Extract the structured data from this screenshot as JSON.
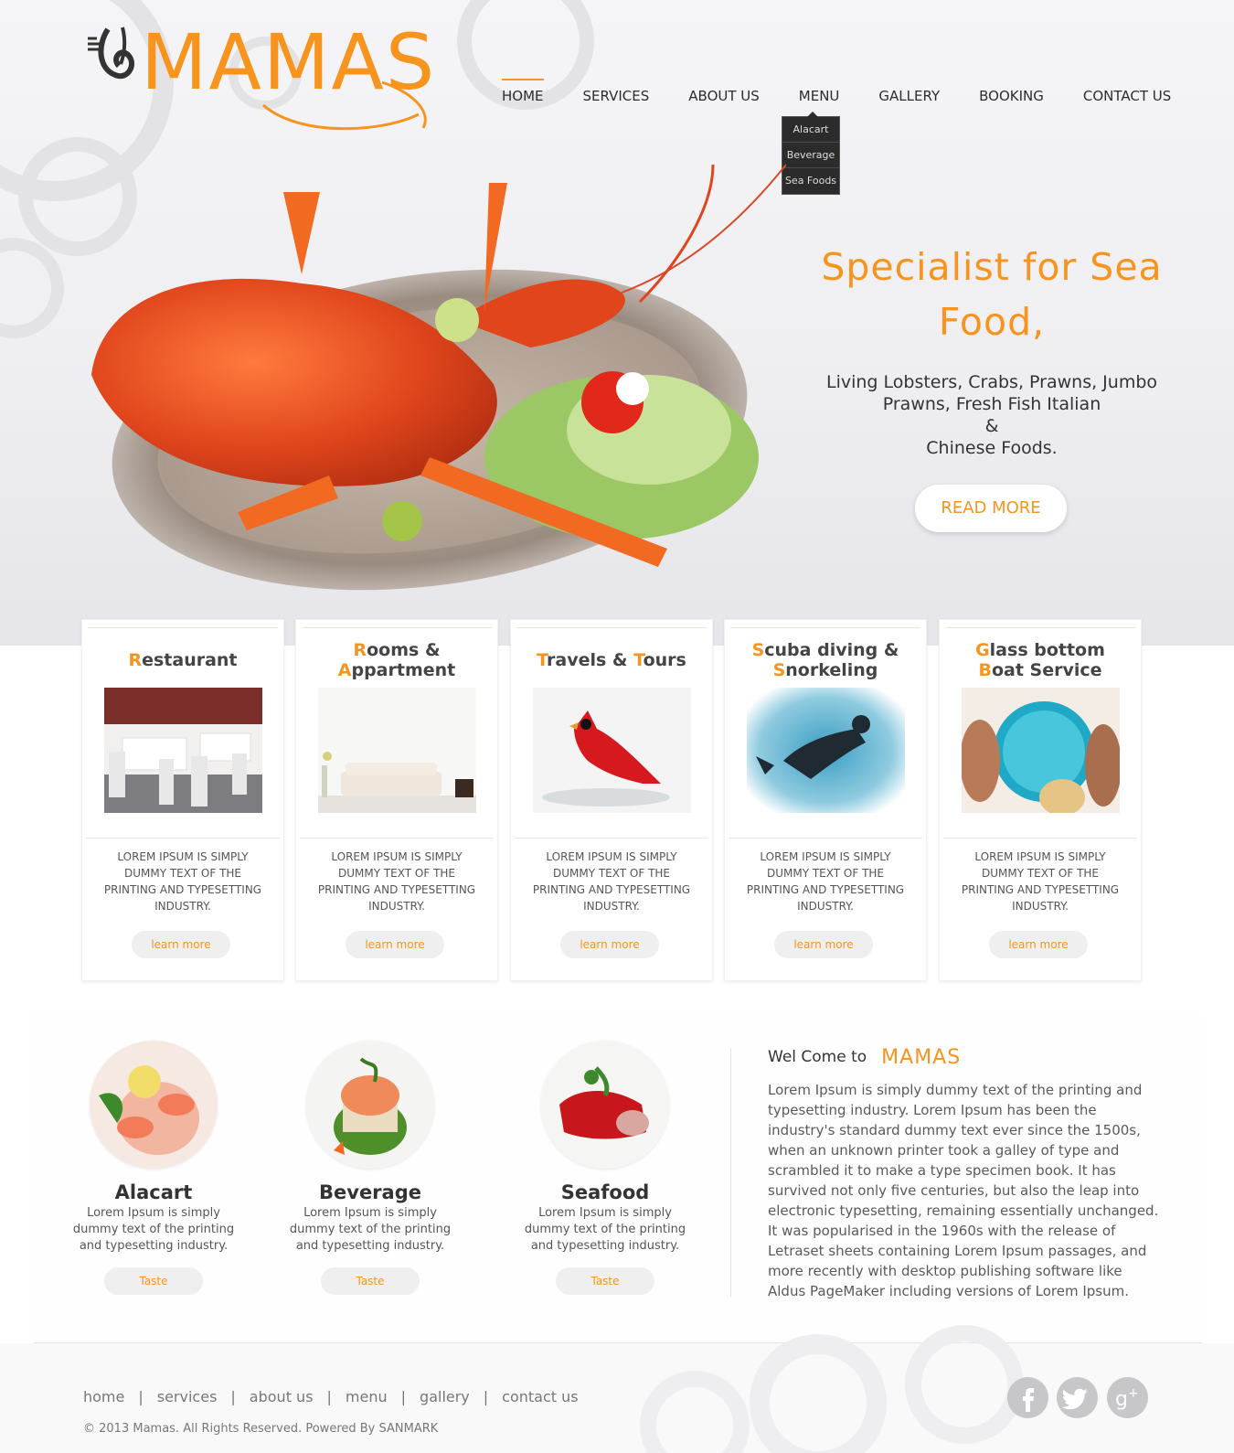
{
  "brand": {
    "name": "MAMAS",
    "accent": "#f7941d"
  },
  "nav": {
    "items": [
      {
        "label": "HOME"
      },
      {
        "label": "SERVICES"
      },
      {
        "label": "ABOUT US"
      },
      {
        "label": "MENU"
      },
      {
        "label": "GALLERY"
      },
      {
        "label": "BOOKING"
      },
      {
        "label": "CONTACT US"
      }
    ],
    "active": "HOME",
    "dropdown": [
      "Alacart",
      "Beverage",
      "Sea Foods"
    ]
  },
  "hero": {
    "title": "Specialist for Sea Food,",
    "subtitle_lines": [
      "Living Lobsters, Crabs, Prawns, Jumbo",
      "Prawns, Fresh Fish Italian",
      "&",
      "Chinese Foods."
    ],
    "button": "READ MORE"
  },
  "cards": [
    {
      "title_line1": {
        "cap": "R",
        "rest": "estaurant"
      },
      "title_line2": null,
      "text": "LOREM IPSUM IS SIMPLY DUMMY TEXT OF THE PRINTING AND TYPESETTING INDUSTRY.",
      "button": "learn more",
      "image": "restaurant-photo"
    },
    {
      "title_line1": {
        "cap": "R",
        "rest": "ooms &"
      },
      "title_line2": {
        "cap": "A",
        "rest": "ppartment"
      },
      "text": "LOREM IPSUM IS SIMPLY DUMMY TEXT OF THE PRINTING AND TYPESETTING INDUSTRY.",
      "button": "learn more",
      "image": "sofa-photo"
    },
    {
      "title_line1": {
        "cap": "T",
        "rest": "ravels & "
      },
      "title_line1b": {
        "cap": "T",
        "rest": "ours"
      },
      "title_line2": null,
      "text": "LOREM IPSUM IS SIMPLY DUMMY TEXT OF THE PRINTING AND TYPESETTING INDUSTRY.",
      "button": "learn more",
      "image": "cardinal-photo"
    },
    {
      "title_line1": {
        "cap": "S",
        "rest": "cuba diving &"
      },
      "title_line2": {
        "cap": "S",
        "rest": "norkeling"
      },
      "text": "LOREM IPSUM IS SIMPLY DUMMY TEXT OF THE PRINTING AND TYPESETTING INDUSTRY.",
      "button": "learn more",
      "image": "diver-photo"
    },
    {
      "title_line1": {
        "cap": "G",
        "rest": "lass bottom"
      },
      "title_line2": {
        "cap": "B",
        "rest": "oat Service"
      },
      "text": "LOREM IPSUM IS SIMPLY DUMMY TEXT OF THE PRINTING AND TYPESETTING INDUSTRY.",
      "button": "learn more",
      "image": "glass-boat-photo"
    }
  ],
  "dishes": [
    {
      "name": "Alacart",
      "text": "Lorem Ipsum is simply dummy text of the printing and typesetting industry.",
      "button": "Taste",
      "image": "shrimp-cocktail-photo"
    },
    {
      "name": "Beverage",
      "text": "Lorem Ipsum is simply dummy text of the printing and typesetting industry.",
      "button": "Taste",
      "image": "salmon-tower-photo"
    },
    {
      "name": "Seafood",
      "text": "Lorem Ipsum is simply dummy text of the printing and typesetting industry.",
      "button": "Taste",
      "image": "stuffed-pepper-photo"
    }
  ],
  "welcome": {
    "label": "Wel Come to",
    "logo": "MAMAS",
    "body": "Lorem Ipsum is simply dummy text of the printing and typesetting industry. Lorem Ipsum has been the industry's standard dummy text ever since the 1500s, when an unknown printer took a galley of type and scrambled it to make a type specimen book. It has survived not only five centuries, but also the leap into electronic typesetting, remaining essentially unchanged. It was popularised in the 1960s with the release of Letraset sheets containing Lorem Ipsum passages, and more recently with desktop publishing software like Aldus PageMaker including versions of Lorem Ipsum."
  },
  "footer": {
    "links": [
      "home",
      "services",
      "about us",
      "menu",
      "gallery",
      "contact us"
    ],
    "separator": "|",
    "copyright": "© 2013 Mamas. All Rights Reserved. Powered By SANMARK",
    "social": [
      "facebook-icon",
      "twitter-icon",
      "google-plus-icon"
    ]
  }
}
